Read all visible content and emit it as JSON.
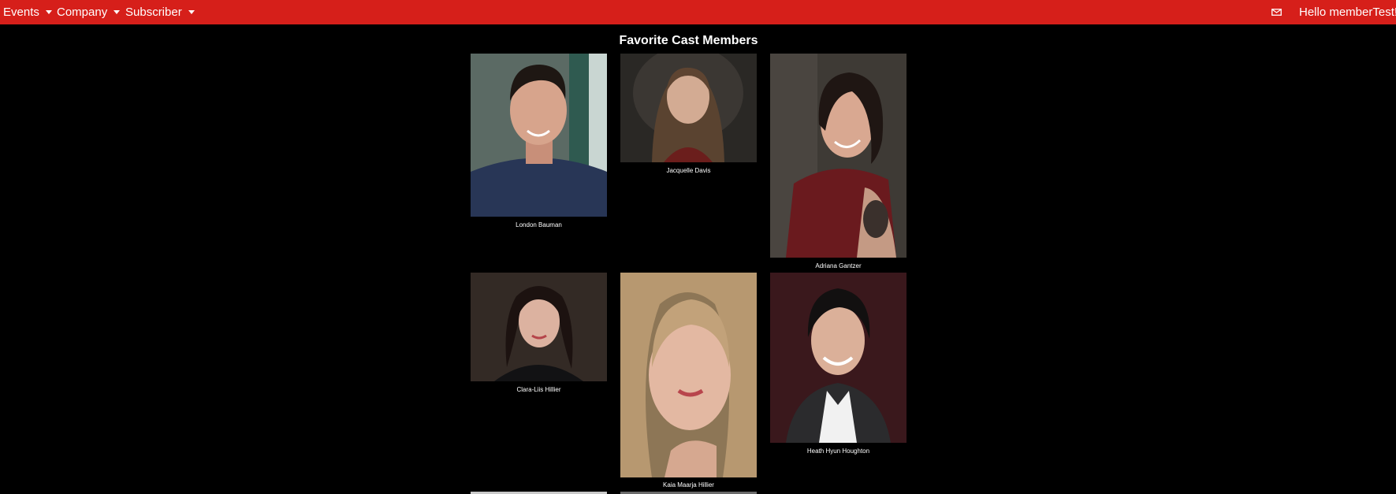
{
  "nav": {
    "events_label": "Events",
    "company_label": "Company",
    "subscriber_label": "Subscriber",
    "greeting": "Hello memberTest!",
    "mail_icon": "envelope-icon"
  },
  "page": {
    "title": "Favorite Cast Members"
  },
  "cast": [
    {
      "name": "London Bauman"
    },
    {
      "name": "Jacquelle Davis"
    },
    {
      "name": "Adriana Gantzer"
    },
    {
      "name": "Clara-Liis Hillier"
    },
    {
      "name": "Kaia Maarja Hillier"
    },
    {
      "name": "Heath Hyun Houghton"
    }
  ]
}
